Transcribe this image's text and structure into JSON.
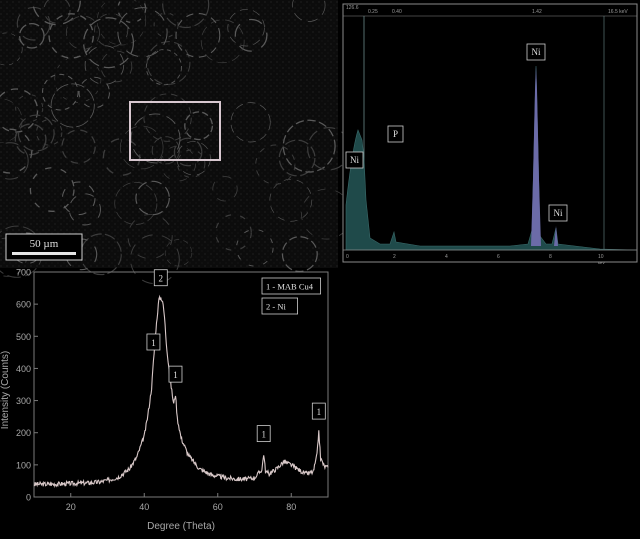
{
  "sem_panel": {
    "scale_bar_label": "50 µm"
  },
  "eds_panel": {
    "header_left": "126.6",
    "header_mid1": "0.25",
    "header_mid2": "0.40",
    "header_right1": "1.42",
    "header_right2": "16.5 keV",
    "peak_labels": [
      "Ni",
      "P",
      "Ni",
      "Ni"
    ],
    "x_unit": "keV",
    "tick_labels": [
      "0",
      "2",
      "4",
      "6",
      "8",
      "10"
    ],
    "colors": {
      "fill": "#1f4a4a",
      "peak": "#6b6ba8",
      "frame": "#8a8a8a"
    }
  },
  "chart_data": {
    "type": "line",
    "xlabel": "Degree (Theta)",
    "ylabel": "Intensity (Counts)",
    "xlim": [
      10,
      90
    ],
    "ylim": [
      0,
      700
    ],
    "x_ticks": [
      20,
      40,
      60,
      80
    ],
    "y_ticks": [
      0,
      100,
      200,
      300,
      400,
      500,
      600,
      700
    ],
    "legend": [
      "1 - MAB Cu4",
      "2 - Ni"
    ],
    "legend_position": "top-right",
    "grid": false,
    "line_color": "#d8c8c8",
    "series": [
      {
        "x": [
          10,
          15,
          20,
          25,
          28,
          30,
          33,
          36,
          38,
          40,
          41,
          42,
          42.5,
          43,
          43.5,
          44,
          44.5,
          45,
          45.5,
          46,
          47,
          48,
          48.5,
          49,
          50,
          52,
          55,
          58,
          62,
          65,
          68,
          70,
          72,
          72.5,
          73,
          74,
          76,
          78,
          80,
          82,
          84,
          86,
          87,
          87.5,
          88,
          89,
          90
        ],
        "y": [
          40,
          40,
          42,
          44,
          47,
          52,
          62,
          88,
          125,
          190,
          255,
          340,
          420,
          500,
          560,
          615,
          620,
          610,
          560,
          480,
          370,
          290,
          320,
          245,
          185,
          130,
          88,
          70,
          60,
          56,
          56,
          60,
          85,
          135,
          80,
          72,
          88,
          110,
          100,
          85,
          72,
          78,
          130,
          205,
          120,
          95,
          92
        ]
      }
    ],
    "peak_labels": [
      {
        "label": "1",
        "x": 42.5
      },
      {
        "label": "2",
        "x": 44.5
      },
      {
        "label": "1",
        "x": 48.5
      },
      {
        "label": "1",
        "x": 72.5
      },
      {
        "label": "1",
        "x": 87.5
      }
    ]
  }
}
